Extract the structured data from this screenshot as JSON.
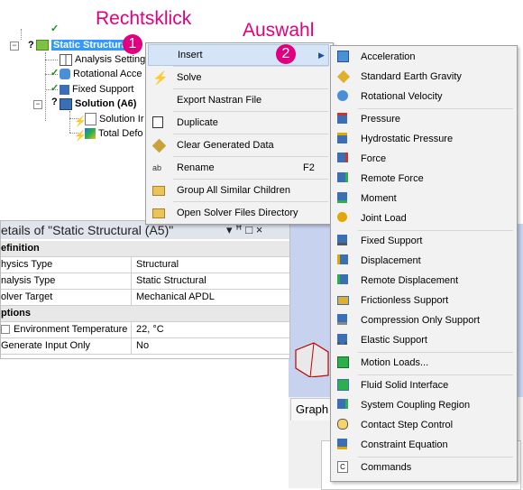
{
  "tree": {
    "static_structural": "Static Structural",
    "analysis_settings": "Analysis Setting",
    "rotational_accel": "Rotational Acce",
    "fixed_support": "Fixed Support",
    "solution": "Solution (A6)",
    "solution_info": "Solution Ir",
    "total_deformation": "Total Defo"
  },
  "annotations": {
    "right_click": "Rechtsklick",
    "selection": "Auswahl",
    "step1": "1",
    "step2": "2"
  },
  "context_menu": {
    "items": [
      {
        "label": "Insert",
        "icon": "insert-icon"
      },
      {
        "label": "Solve",
        "icon": "lightning-icon"
      },
      {
        "label": "Export Nastran File",
        "icon": "export-icon"
      },
      {
        "label": "Duplicate",
        "icon": "duplicate-icon"
      },
      {
        "label": "Clear Generated Data",
        "icon": "clear-icon"
      },
      {
        "label": "Rename",
        "icon": "rename-icon",
        "shortcut": "F2"
      },
      {
        "label": "Group All Similar Children",
        "icon": "folder-icon"
      },
      {
        "label": "Open Solver Files Directory",
        "icon": "open-folder-icon"
      }
    ],
    "submenu_arrow": "▶"
  },
  "submenu": {
    "items": [
      "Acceleration",
      "Standard Earth Gravity",
      "Rotational Velocity",
      "Pressure",
      "Hydrostatic Pressure",
      "Force",
      "Remote Force",
      "Moment",
      "Joint Load",
      "Fixed Support",
      "Displacement",
      "Remote Displacement",
      "Frictionless Support",
      "Compression Only Support",
      "Elastic Support",
      "Motion Loads...",
      "Fluid Solid Interface",
      "System Coupling Region",
      "Contact Step Control",
      "Constraint Equation",
      "Commands"
    ]
  },
  "details": {
    "title": "etails of \"Static Structural (A5)\"",
    "title_controls": "▾ ꟸ □ ×",
    "groups": {
      "definition": "efinition",
      "options": "ptions"
    },
    "rows": {
      "physics_type_key": "hysics Type",
      "physics_type_val": "Structural",
      "analysis_type_key": "nalysis Type",
      "analysis_type_val": "Static Structural",
      "solver_target_key": "olver Target",
      "solver_target_val": "Mechanical APDL",
      "env_temp_key": "Environment Temperature",
      "env_temp_val": "22, °C",
      "gen_input_key": "Generate Input Only",
      "gen_input_val": "No"
    }
  },
  "graph_tab": "Graph",
  "colors": {
    "accent": "#e0007f",
    "menu_bg": "#f2f2f2",
    "hover": "#d5e5f7",
    "viewport": "#c6d2ee"
  }
}
